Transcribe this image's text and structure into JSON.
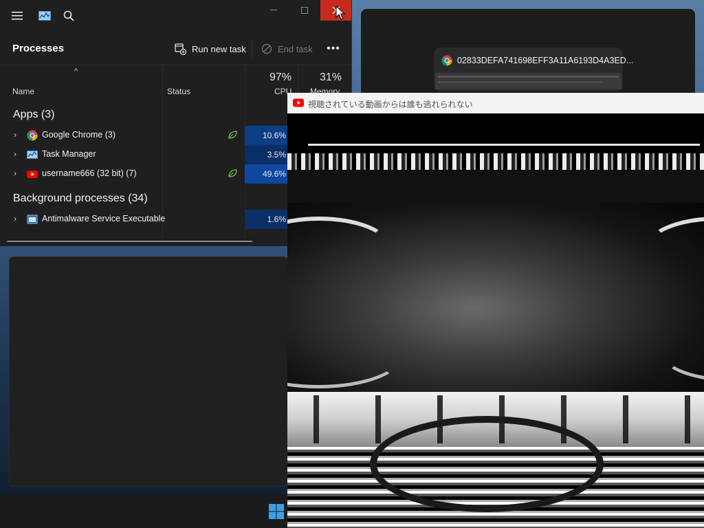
{
  "task_manager": {
    "heading": "Processes",
    "run_new_task": "Run new task",
    "end_task": "End task",
    "more": "•••",
    "columns": {
      "sort_indicator": "^",
      "name": "Name",
      "status": "Status",
      "cpu_percent": "97%",
      "cpu": "CPU",
      "memory_percent": "31%",
      "memory": "Memory"
    },
    "groups": {
      "apps": "Apps (3)",
      "background": "Background processes (34)"
    },
    "rows": [
      {
        "name": "Google Chrome (3)",
        "cpu": "10.6%"
      },
      {
        "name": "Task Manager",
        "cpu": "3.5%"
      },
      {
        "name": "username666 (32 bit) (7)",
        "cpu": "49.6%"
      },
      {
        "name": "Antimalware Service Executable",
        "cpu": "1.6%"
      }
    ]
  },
  "taskview": {
    "chrome_title": "02833DEFA741698EFF3A11A6193D4A3ED..."
  },
  "youtube_window": {
    "title": "視聴されている動画からは誰も逃れられない"
  },
  "colors": {
    "accent": "#0c3e86",
    "close": "#c42b1c",
    "youtube_red": "#ff0000",
    "eco_green": "#6cc04a"
  }
}
